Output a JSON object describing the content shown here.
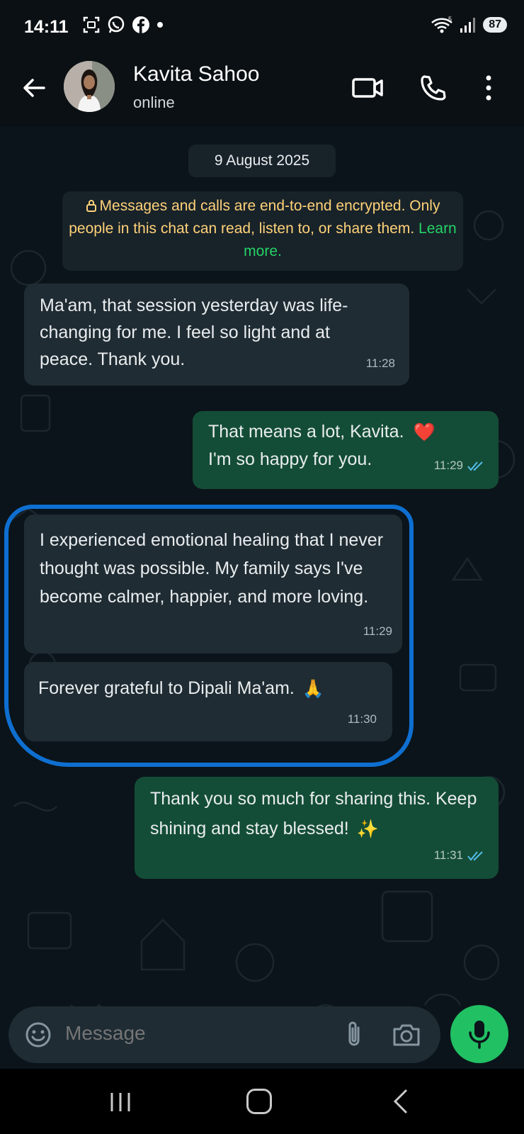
{
  "status_bar": {
    "time": "14:11",
    "battery": "87",
    "signal_label": "5"
  },
  "header": {
    "contact_name": "Kavita Sahoo",
    "contact_status": "online"
  },
  "date_chip": "9 August 2025",
  "encryption": {
    "text": "Messages and calls are end-to-end encrypted. Only people in this chat can read, listen to, or share them.",
    "link": "Learn more."
  },
  "messages": [
    {
      "direction": "incoming",
      "text": "Ma'am, that session yesterday was life-changing for me. I feel so light and at peace. Thank you.",
      "time": "11:28"
    },
    {
      "direction": "outgoing",
      "text": "That means a lot, Kavita.",
      "emoji": "❤️",
      "text2": "I'm so happy for you.",
      "time": "11:29",
      "status": "read"
    },
    {
      "direction": "incoming",
      "text": "I experienced emotional healing that I never thought was possible. My family says I've become calmer, happier, and more loving.",
      "time": "11:29"
    },
    {
      "direction": "incoming",
      "text": "Forever grateful to Dipali Ma'am.",
      "emoji": "🙏",
      "time": "11:30"
    },
    {
      "direction": "outgoing",
      "text": "Thank you so much for sharing this. Keep shining and stay blessed!",
      "emoji": "✨",
      "time": "11:31",
      "status": "read"
    }
  ],
  "input": {
    "placeholder": "Message"
  },
  "colors": {
    "incoming_bubble": "#202c33",
    "outgoing_bubble": "#144d37",
    "accent": "#21c063",
    "highlight": "#0e6fd1",
    "encryption_text": "#ffd279"
  }
}
